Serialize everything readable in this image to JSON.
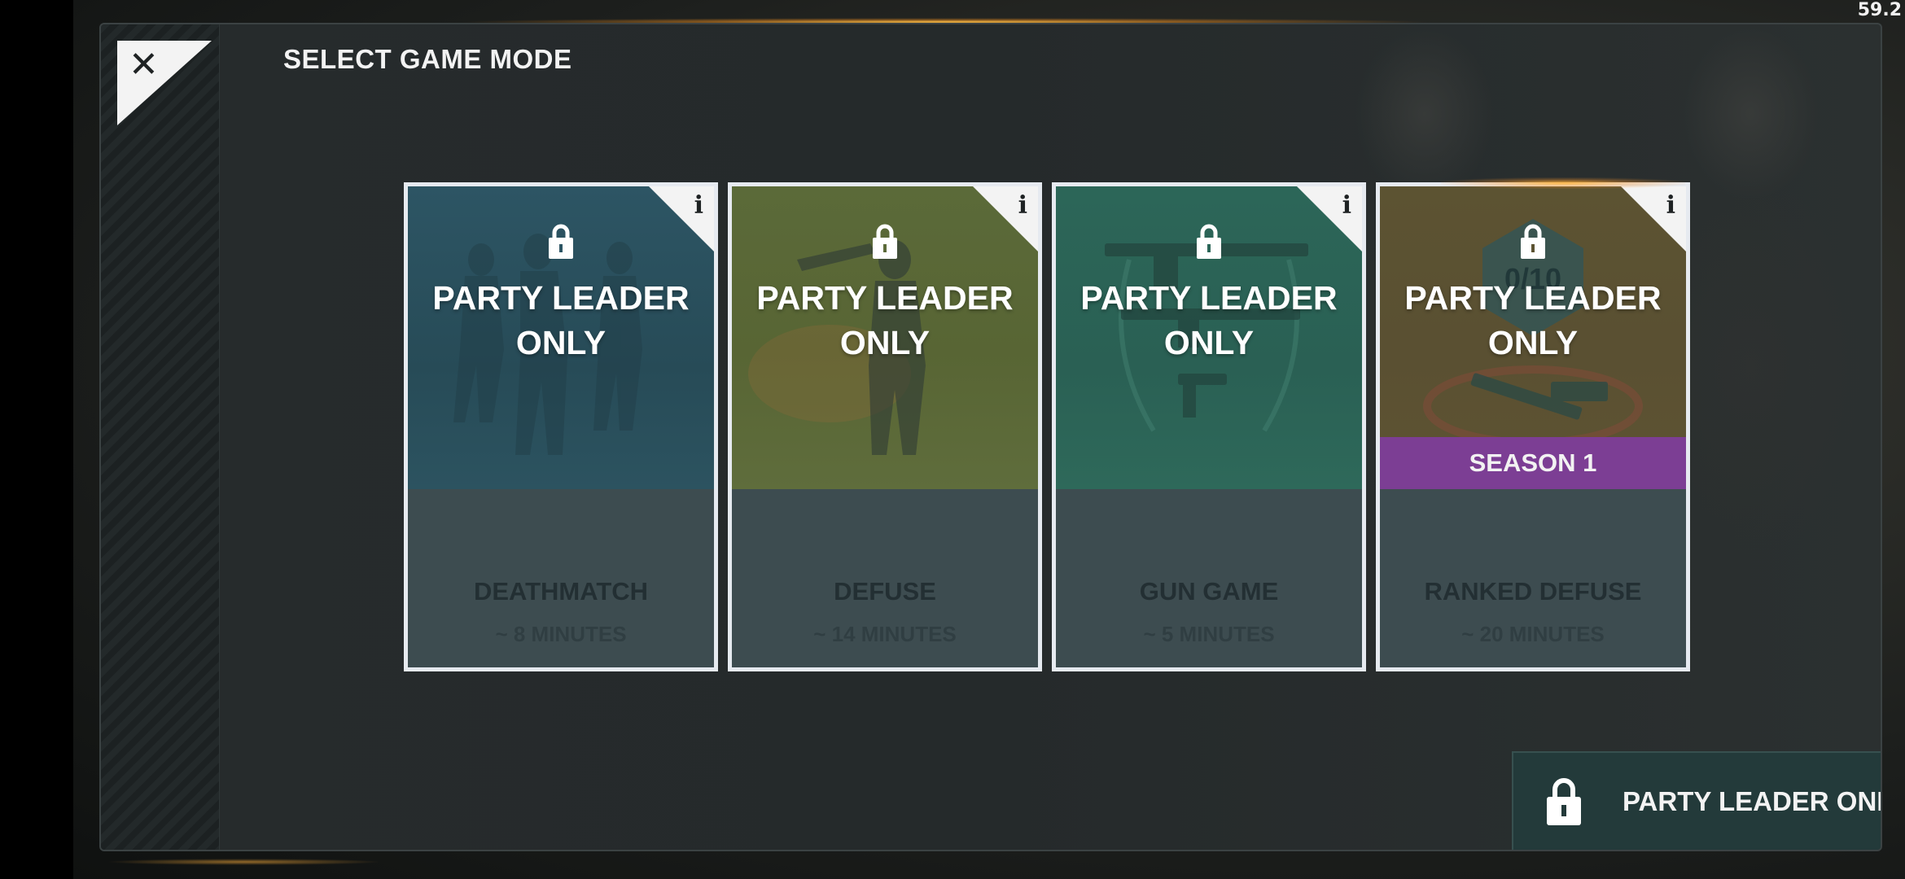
{
  "status": {
    "fps": "59.2"
  },
  "header": {
    "title": "SELECT GAME MODE",
    "close_label": "✕"
  },
  "modes": [
    {
      "overlay_line1": "PARTY LEADER",
      "overlay_line2": "ONLY",
      "name": "DEATHMATCH",
      "duration": "~ 8 MINUTES",
      "info": "i",
      "accent": "#2d5564"
    },
    {
      "overlay_line1": "PARTY LEADER",
      "overlay_line2": "ONLY",
      "name": "DEFUSE",
      "duration": "~ 14 MINUTES",
      "info": "i",
      "accent": "#5b6a39"
    },
    {
      "overlay_line1": "PARTY LEADER",
      "overlay_line2": "ONLY",
      "name": "GUN GAME",
      "duration": "~ 5 MINUTES",
      "info": "i",
      "accent": "#2c6658"
    },
    {
      "overlay_line1": "PARTY LEADER",
      "overlay_line2": "ONLY",
      "name": "RANKED DEFUSE",
      "duration": "~ 20 MINUTES",
      "info": "i",
      "badge": "SEASON 1",
      "rank_text": "0/10",
      "accent": "#5c5332"
    }
  ],
  "footer": {
    "status_label": "PARTY LEADER ONLY",
    "icon": "lock-icon"
  },
  "colors": {
    "season_badge": "#7c3e94",
    "card_border": "#e6eaf0",
    "card_body": "#3d4c50",
    "footer_bg": "#233a3a"
  }
}
